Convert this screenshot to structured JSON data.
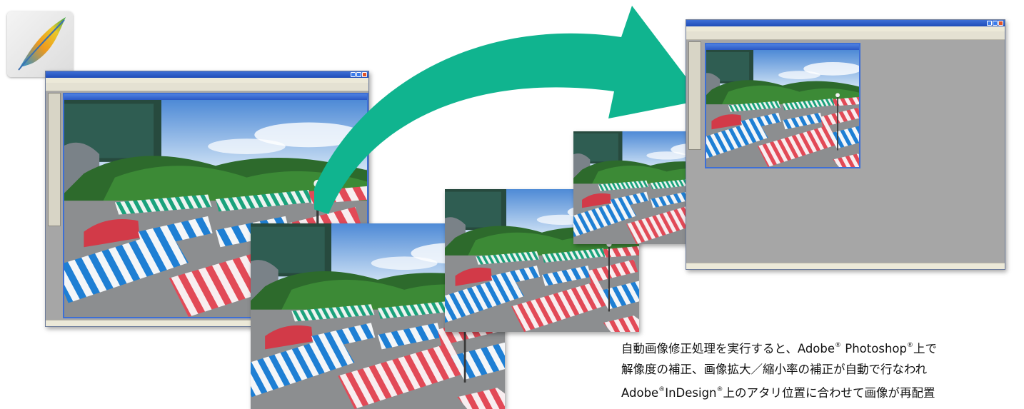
{
  "caption": {
    "line1_pre": "自動画像修正処理を実行すると、Adobe",
    "line1_mid": " Photoshop",
    "line1_post": "上で",
    "line2": "解像度の補正、画像拡大／縮小率の補正が自動で行なわれ",
    "line3_pre": "Adobe",
    "line3_mid": "InDesign",
    "line3_post": "上のアタリ位置に合わせて画像が再配置",
    "registered_mark": "®"
  },
  "colors": {
    "arrow": "#10b48f",
    "window_title": "#2a58c4",
    "workspace": "#a6a6a6"
  },
  "icons": {
    "app_logo": "feather-logo-icon",
    "arrow": "curved-arrow-icon"
  }
}
